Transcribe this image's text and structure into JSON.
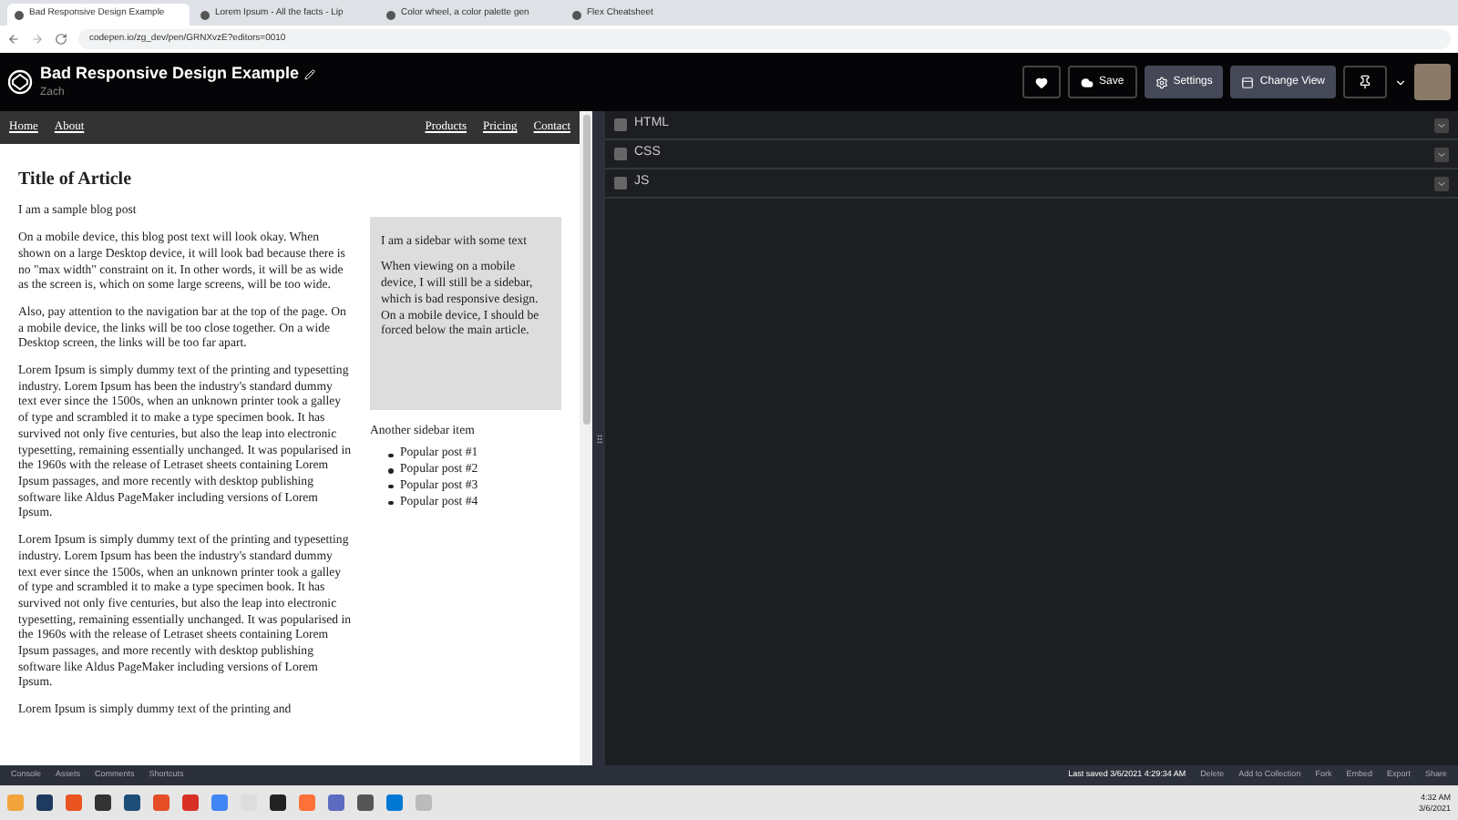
{
  "browser": {
    "tabs": [
      {
        "title": "Bad Responsive Design Example",
        "selected": true
      },
      {
        "title": "Lorem Ipsum - All the facts - Lip",
        "selected": false
      },
      {
        "title": "Color wheel, a color palette gen",
        "selected": false
      },
      {
        "title": "Flex Cheatsheet",
        "selected": false
      }
    ],
    "url": "codepen.io/zg_dev/pen/GRNXvzE?editors=0010"
  },
  "header": {
    "title": "Bad Responsive Design Example",
    "author": "Zach",
    "buttons": [
      {
        "kind": "heart"
      },
      {
        "kind": "save",
        "label": "Save"
      },
      {
        "kind": "settings",
        "label": "Settings"
      },
      {
        "kind": "view",
        "label": "Change View"
      }
    ]
  },
  "preview": {
    "nav_left": [
      "Home",
      "About"
    ],
    "nav_right": [
      "Products",
      "Pricing",
      "Contact"
    ],
    "article": {
      "title": "Title of Article",
      "paragraphs": [
        "I am a sample blog post",
        "On a mobile device, this blog post text will look okay. When shown on a large Desktop device, it will look bad because there is no \"max width\" constraint on it. In other words, it will be as wide as the screen is, which on some large screens, will be too wide.",
        "Also, pay attention to the navigation bar at the top of the page. On a mobile device, the links will be too close together. On a wide Desktop screen, the links will be too far apart.",
        "Lorem Ipsum is simply dummy text of the printing and typesetting industry. Lorem Ipsum has been the industry's standard dummy text ever since the 1500s, when an unknown printer took a galley of type and scrambled it to make a type specimen book. It has survived not only five centuries, but also the leap into electronic typesetting, remaining essentially unchanged. It was popularised in the 1960s with the release of Letraset sheets containing Lorem Ipsum passages, and more recently with desktop publishing software like Aldus PageMaker including versions of Lorem Ipsum.",
        "Lorem Ipsum is simply dummy text of the printing and typesetting industry. Lorem Ipsum has been the industry's standard dummy text ever since the 1500s, when an unknown printer took a galley of type and scrambled it to make a type specimen book. It has survived not only five centuries, but also the leap into electronic typesetting, remaining essentially unchanged. It was popularised in the 1960s with the release of Letraset sheets containing Lorem Ipsum passages, and more recently with desktop publishing software like Aldus PageMaker including versions of Lorem Ipsum.",
        "Lorem Ipsum is simply dummy text of the printing and"
      ]
    },
    "sidebar": {
      "box": [
        "I am a sidebar with some text",
        "When viewing on a mobile device, I will still be a sidebar, which is bad responsive design. On a mobile device, I should be forced below the main article."
      ],
      "heading": "Another sidebar item",
      "items": [
        "Popular post #1",
        "Popular post #2",
        "Popular post #3",
        "Popular post #4"
      ]
    }
  },
  "editors": [
    "HTML",
    "CSS",
    "JS"
  ],
  "footer": {
    "left": [
      "Console",
      "Assets",
      "Comments",
      "Shortcuts"
    ],
    "last_saved": "Last saved 3/6/2021 4:29:34 AM",
    "right": [
      "Delete",
      "Add to Collection",
      "Fork",
      "Embed",
      "Export",
      "Share"
    ]
  },
  "taskbar": {
    "time": "4:32 AM",
    "date": "3/6/2021"
  }
}
